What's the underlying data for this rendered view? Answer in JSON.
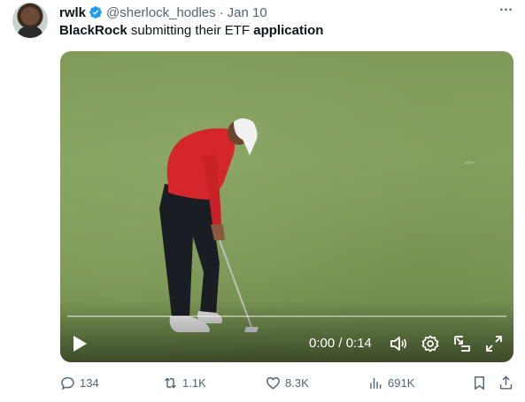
{
  "tweet": {
    "author_name": "rwlk",
    "author_handle": "@sherlock_hodles",
    "separator": "·",
    "date": "Jan 10",
    "text_parts": [
      "BlackRock",
      " submitting their ETF ",
      "application"
    ]
  },
  "video": {
    "time_display": "0:00 / 0:14",
    "progress": 0.0,
    "controls": [
      "play-icon",
      "volume-icon",
      "settings-icon",
      "pip-icon",
      "fullscreen-icon"
    ]
  },
  "actions": {
    "replies": "134",
    "reposts": "1.1K",
    "likes": "8.3K",
    "views": "691K"
  },
  "colors": {
    "verified": "#1d9bf0",
    "secondary_text": "#536471",
    "primary_text": "#0f1419"
  }
}
